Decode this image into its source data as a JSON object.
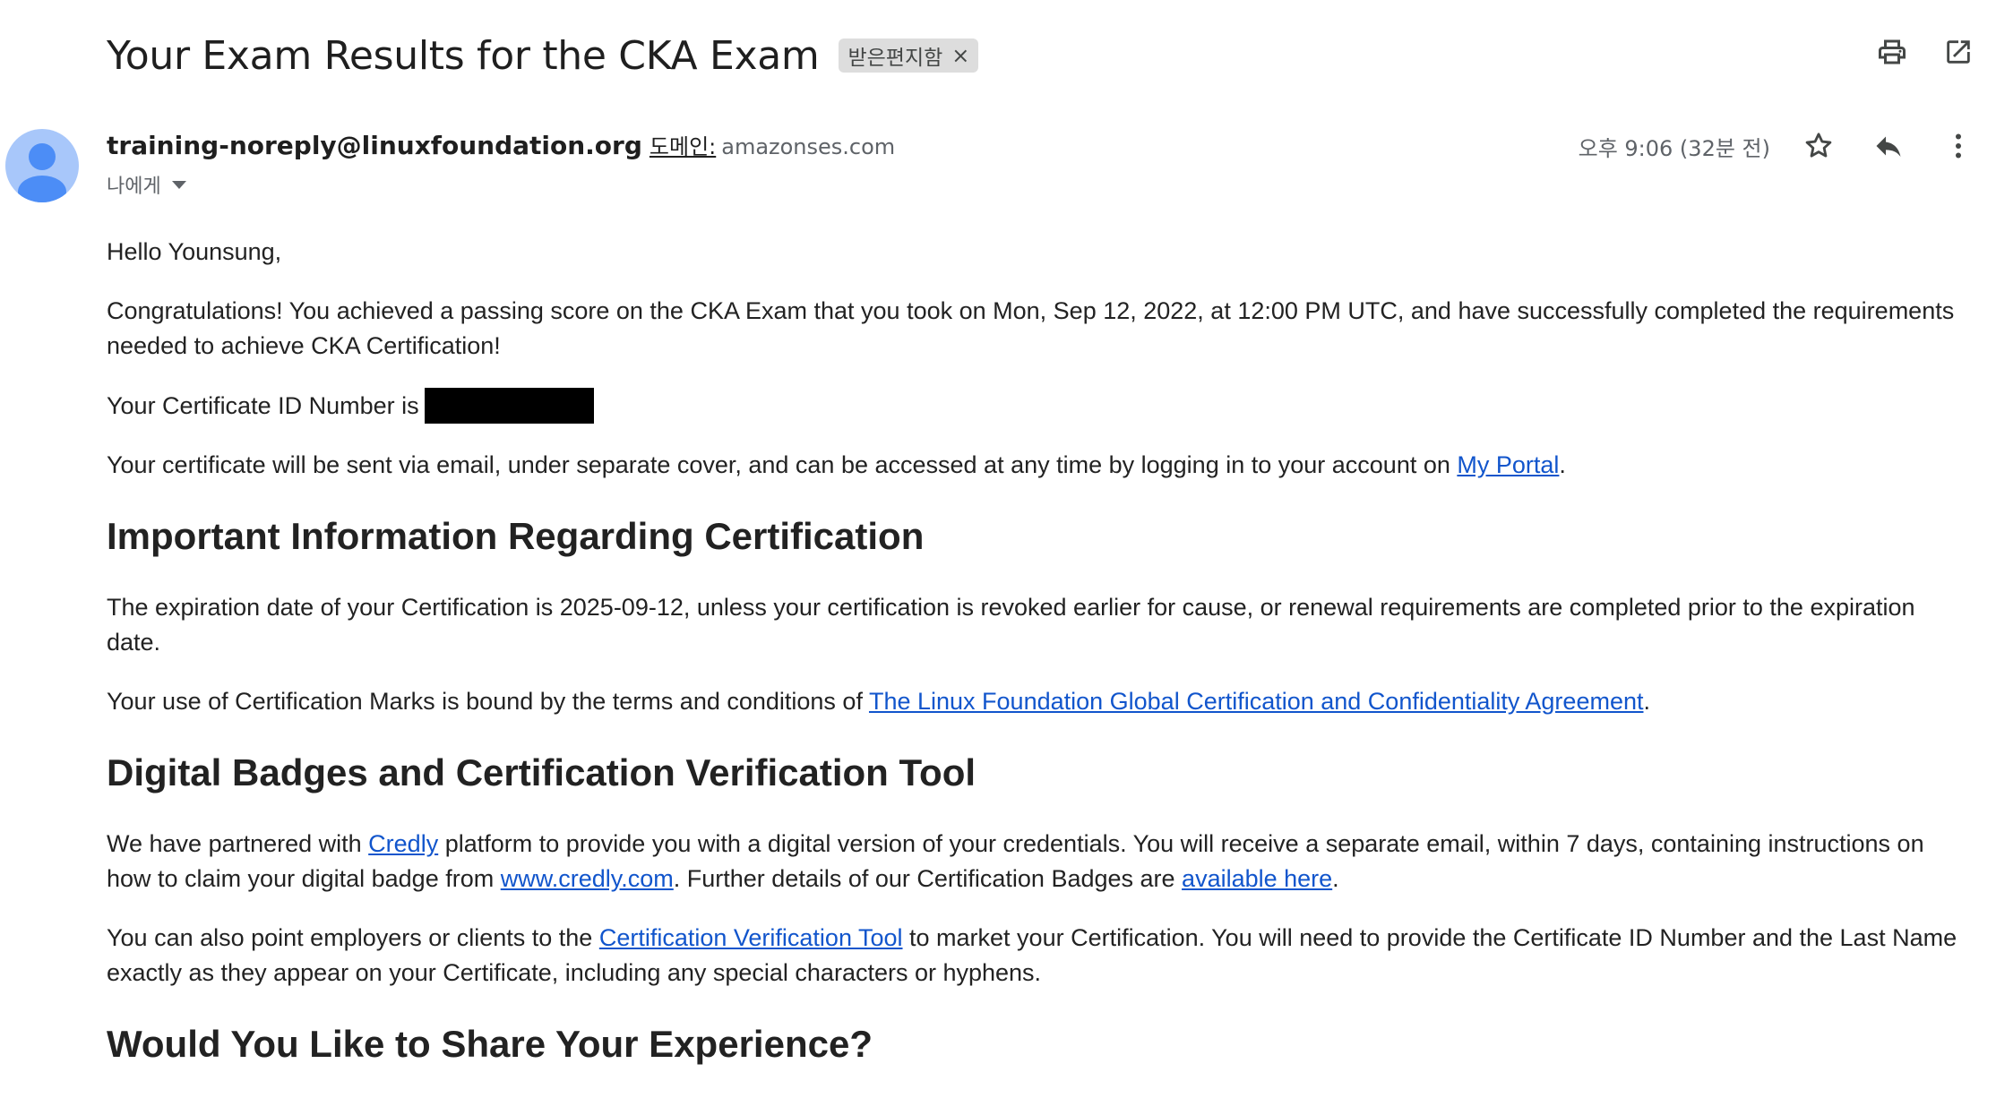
{
  "header": {
    "subject": "Your Exam Results for the CKA Exam",
    "label_chip": "받은편지함",
    "label_remove": "×",
    "icons": [
      "print-icon",
      "open-in-new-window-icon"
    ]
  },
  "sender": {
    "email": "training-noreply@linuxfoundation.org",
    "domain_label": "도메인:",
    "domain_value": "amazonses.com",
    "recipient": "나에게",
    "timestamp": "오후 9:06 (32분 전)",
    "icons": [
      "star-icon",
      "reply-icon",
      "more-vert-icon"
    ]
  },
  "body": {
    "greeting": "Hello Younsung,",
    "congrats": "Congratulations! You achieved a passing score on the CKA Exam that you took on Mon, Sep 12, 2022, at 12:00 PM UTC, and have successfully completed the requirements needed to achieve CKA Certification!",
    "cert_id_prefix": "Your Certificate ID Number is",
    "cert_sent_prefix": "Your certificate will be sent via email, under separate cover, and can be accessed at any time by logging in to your account on ",
    "my_portal_link": "My Portal",
    "period": ".",
    "h_important": "Important Information Regarding Certification",
    "expiration": "The expiration date of your Certification is 2025-09-12, unless your certification is revoked earlier for cause, or renewal requirements are completed prior to the expiration date.",
    "marks_prefix": "Your use of Certification Marks is bound by the terms and conditions of ",
    "agreement_link": "The Linux Foundation Global Certification and Confidentiality Agreement",
    "h_badges": "Digital Badges and Certification Verification Tool",
    "partnered_prefix": "We have partnered with ",
    "credly_link": "Credly",
    "partnered_middle": " platform to provide you with a digital version of your credentials. You will receive a separate email, within 7 days, containing instructions on how to claim your digital badge from ",
    "credly_site_link": "www.credly.com",
    "partnered_after": ". Further details of our Certification Badges are ",
    "available_here_link": "available here",
    "verify_prefix": "You can also point employers or clients to the ",
    "verify_link": "Certification Verification Tool",
    "verify_suffix": " to market your Certification. You will need to provide the Certificate ID Number and the Last Name exactly as they appear on your Certificate, including any special characters or hyphens.",
    "h_share": "Would You Like to Share Your Experience?"
  },
  "colors": {
    "link": "#1155cc",
    "avatar": "#a8c7fa",
    "avatar_figure": "#4c8df6",
    "chip_bg": "#dddddd"
  }
}
